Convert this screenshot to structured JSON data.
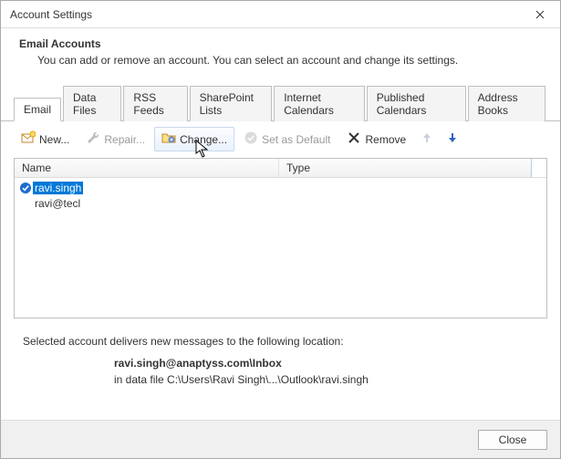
{
  "window": {
    "title": "Account Settings"
  },
  "header": {
    "title": "Email Accounts",
    "subtitle": "You can add or remove an account. You can select an account and change its settings."
  },
  "tabs": [
    {
      "label": "Email",
      "active": true
    },
    {
      "label": "Data Files"
    },
    {
      "label": "RSS Feeds"
    },
    {
      "label": "SharePoint Lists"
    },
    {
      "label": "Internet Calendars"
    },
    {
      "label": "Published Calendars"
    },
    {
      "label": "Address Books"
    }
  ],
  "toolbar": {
    "new_label": "New...",
    "repair_label": "Repair...",
    "change_label": "Change...",
    "default_label": "Set as Default",
    "remove_label": "Remove"
  },
  "columns": {
    "name": "Name",
    "type": "Type"
  },
  "accounts": [
    {
      "label": "ravi.singh",
      "default": true,
      "selected": true
    },
    {
      "label": "ravi@tecl",
      "default": false,
      "selected": false
    }
  ],
  "delivery": {
    "intro": "Selected account delivers new messages to the following location:",
    "location_bold": "ravi.singh@anaptyss.com\\Inbox",
    "location_line": "in data file C:\\Users\\Ravi Singh\\...\\Outlook\\ravi.singh"
  },
  "footer": {
    "close_label": "Close"
  }
}
